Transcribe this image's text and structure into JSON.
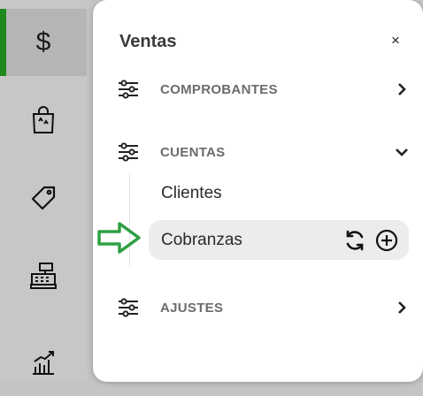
{
  "rail": {
    "items": [
      {
        "name": "ventas",
        "icon": "dollar-icon",
        "glyph": "$",
        "active": true
      },
      {
        "name": "compras",
        "icon": "shopping-bag-icon"
      },
      {
        "name": "etiquetas",
        "icon": "tag-icon"
      },
      {
        "name": "caja",
        "icon": "cash-register-icon"
      },
      {
        "name": "reportes",
        "icon": "chart-icon"
      }
    ],
    "active_color": "#1e8a1e"
  },
  "panel": {
    "title": "Ventas",
    "close_glyph": "×",
    "sections": [
      {
        "label": "COMPROBANTES",
        "expanded": false
      },
      {
        "label": "CUENTAS",
        "expanded": true,
        "items": [
          {
            "label": "Clientes",
            "selected": false
          },
          {
            "label": "Cobranzas",
            "selected": true,
            "actions": [
              "refresh-icon",
              "add-circle-icon"
            ]
          }
        ]
      },
      {
        "label": "AJUSTES",
        "expanded": false
      }
    ]
  },
  "pointer": {
    "icon": "arrow-right-icon",
    "color": "#2ea043"
  }
}
